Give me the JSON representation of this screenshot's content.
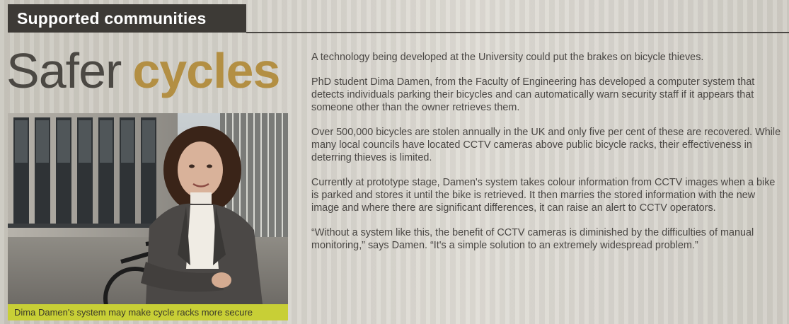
{
  "section": {
    "label": "Supported communities"
  },
  "headline": {
    "light": "Safer",
    "bold": "cycles"
  },
  "photo": {
    "caption": "Dima Damen's system may make cycle racks more secure"
  },
  "article": {
    "paragraphs": [
      "A technology being developed at the University could put the brakes on bicycle thieves.",
      "PhD student Dima Damen, from the Faculty of Engineering has developed a computer system that detects individuals parking their bicycles and can automatically warn security staff if it appears that someone other than the owner retrieves them.",
      "Over 500,000 bicycles are stolen annually in the UK and only five per cent of these are recovered. While many local councils have located CCTV cameras above public bicycle racks, their effectiveness in deterring thieves is limited.",
      "Currently at prototype stage, Damen's system takes colour information from CCTV images when a bike is parked and stores it until the bike is retrieved. It then marries the stored information with the new image and where there are significant differences, it can raise an alert to CCTV operators.",
      "“Without a system like this, the benefit of CCTV cameras is diminished by the difficulties of manual monitoring,” says Damen. “It's a simple solution to an extremely widespread problem.”"
    ]
  },
  "colors": {
    "tab_background": "#3d3a36",
    "headline_accent": "#b38f43",
    "caption_background": "#c8cf36",
    "body_text": "#4a4744"
  }
}
